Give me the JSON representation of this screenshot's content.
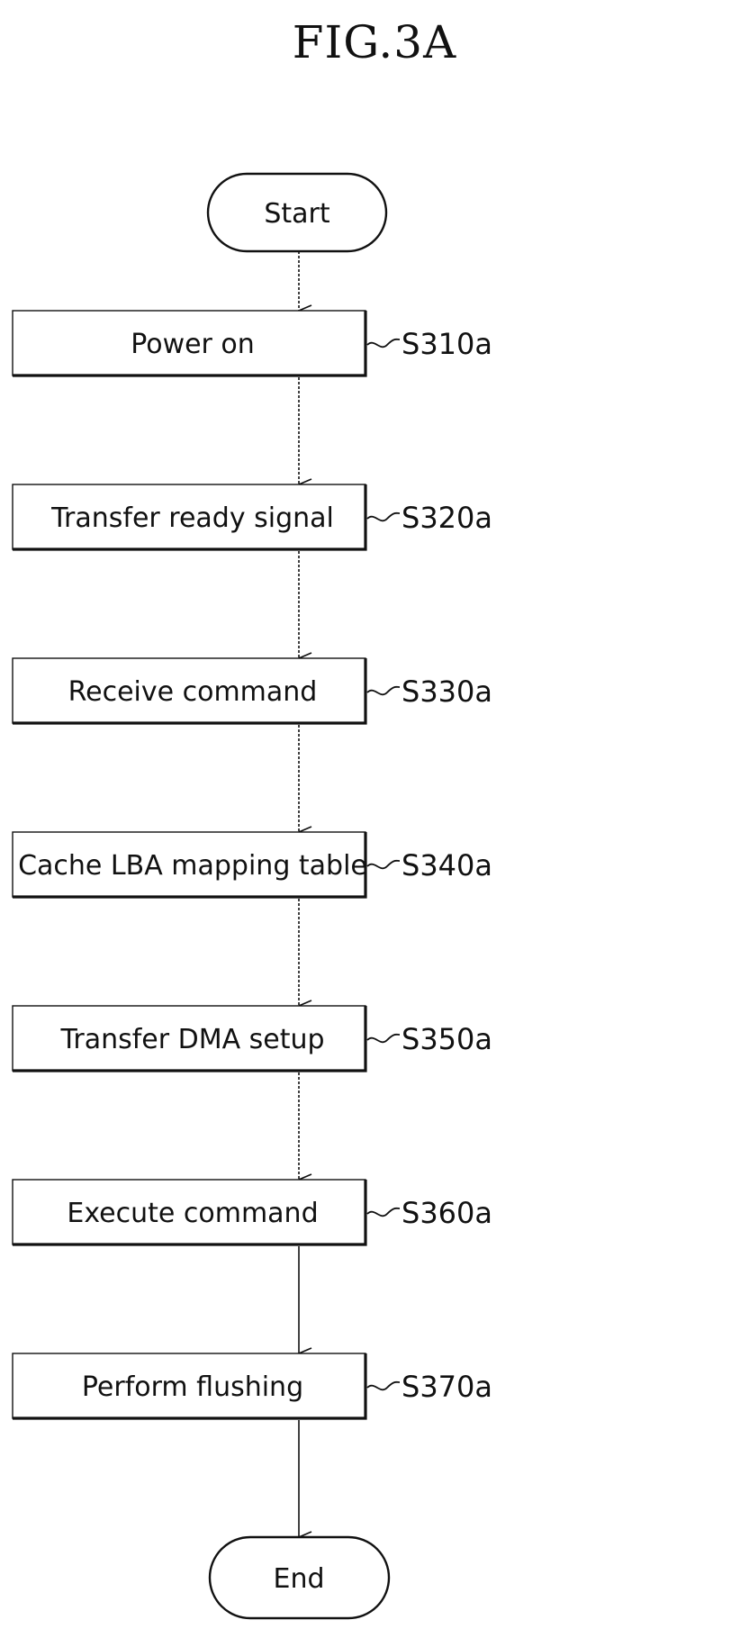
{
  "figure": {
    "title": "FIG.3A"
  },
  "flowchart": {
    "start": {
      "label": "Start"
    },
    "steps": [
      {
        "label": "Power on",
        "ref": "S310a"
      },
      {
        "label": "Transfer ready signal",
        "ref": "S320a"
      },
      {
        "label": "Receive command",
        "ref": "S330a"
      },
      {
        "label": "Cache LBA mapping table",
        "ref": "S340a"
      },
      {
        "label": "Transfer DMA setup",
        "ref": "S350a"
      },
      {
        "label": "Execute command",
        "ref": "S360a"
      },
      {
        "label": "Perform flushing",
        "ref": "S370a"
      }
    ],
    "end": {
      "label": "End"
    }
  }
}
